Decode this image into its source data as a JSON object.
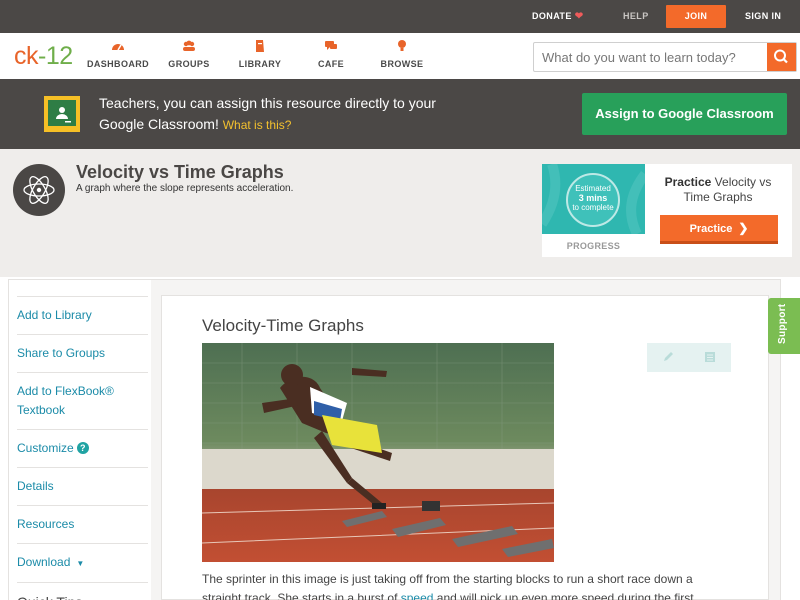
{
  "topbar": {
    "donate": "DONATE",
    "help": "HELP",
    "join": "JOIN",
    "signin": "SIGN IN"
  },
  "nav": {
    "logo_ck": "ck",
    "logo_dash": "-",
    "logo_num": "12",
    "items": [
      {
        "label": "DASHBOARD",
        "icon": "dashboard-icon"
      },
      {
        "label": "GROUPS",
        "icon": "groups-icon"
      },
      {
        "label": "LIBRARY",
        "icon": "library-icon"
      },
      {
        "label": "CAFE",
        "icon": "cafe-icon"
      },
      {
        "label": "BROWSE",
        "icon": "browse-icon"
      }
    ],
    "search_placeholder": "What do you want to learn today?"
  },
  "banner": {
    "text": "Teachers, you can assign this resource directly to your Google Classroom!",
    "whatis": "What is this?",
    "button": "Assign to Google Classroom"
  },
  "header": {
    "title": "Velocity vs Time Graphs",
    "subtitle": "A graph where the slope represents acceleration.",
    "practice": {
      "estimated": "Estimated",
      "mins": "3 mins",
      "to_complete": "to complete",
      "progress": "PROGRESS",
      "title_bold": "Practice",
      "title_rest": "Velocity vs Time Graphs",
      "button": "Practice"
    }
  },
  "sidebar": {
    "items": [
      {
        "label": "Add to Library"
      },
      {
        "label": "Share to Groups"
      },
      {
        "label": "Add to FlexBook® Textbook"
      },
      {
        "label": "Customize"
      },
      {
        "label": "Details"
      },
      {
        "label": "Resources"
      },
      {
        "label": "Download"
      }
    ],
    "quick_tips": "Quick Tips"
  },
  "content": {
    "title": "Velocity-Time Graphs",
    "para_before": "The sprinter in this image is just taking off from the starting blocks to run a short race down a straight track. She starts in a burst of ",
    "para_link": "speed",
    "para_after": " and will pick up even more speed during the first"
  },
  "support": "Support",
  "colors": {
    "accent_orange": "#f36a2a",
    "banner_bg": "#4b4846",
    "assign_green": "#28a05a",
    "link_teal": "#1b8ba8",
    "support_green": "#7bbd52"
  }
}
